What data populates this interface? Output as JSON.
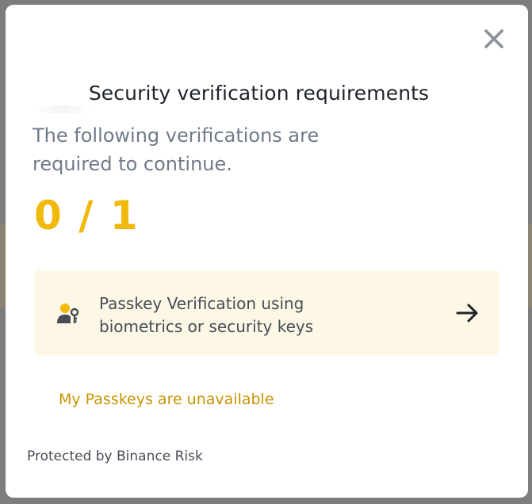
{
  "modal": {
    "title": "Security verification requirements",
    "subtitle": "The following verifications are required to continue.",
    "progress": "0 / 1",
    "options": [
      {
        "label": "Passkey Verification using biometrics or security keys",
        "icon": "passkey-user-icon",
        "action_icon": "arrow-right-icon"
      }
    ],
    "alternate_link": "My Passkeys are unavailable",
    "footer": "Protected by Binance Risk",
    "close_icon": "close-icon"
  },
  "colors": {
    "accent": "#f0b90b",
    "link": "#c99400",
    "card_bg": "#fdf8e6",
    "text_primary": "#1e2329",
    "text_secondary": "#707a8a"
  }
}
